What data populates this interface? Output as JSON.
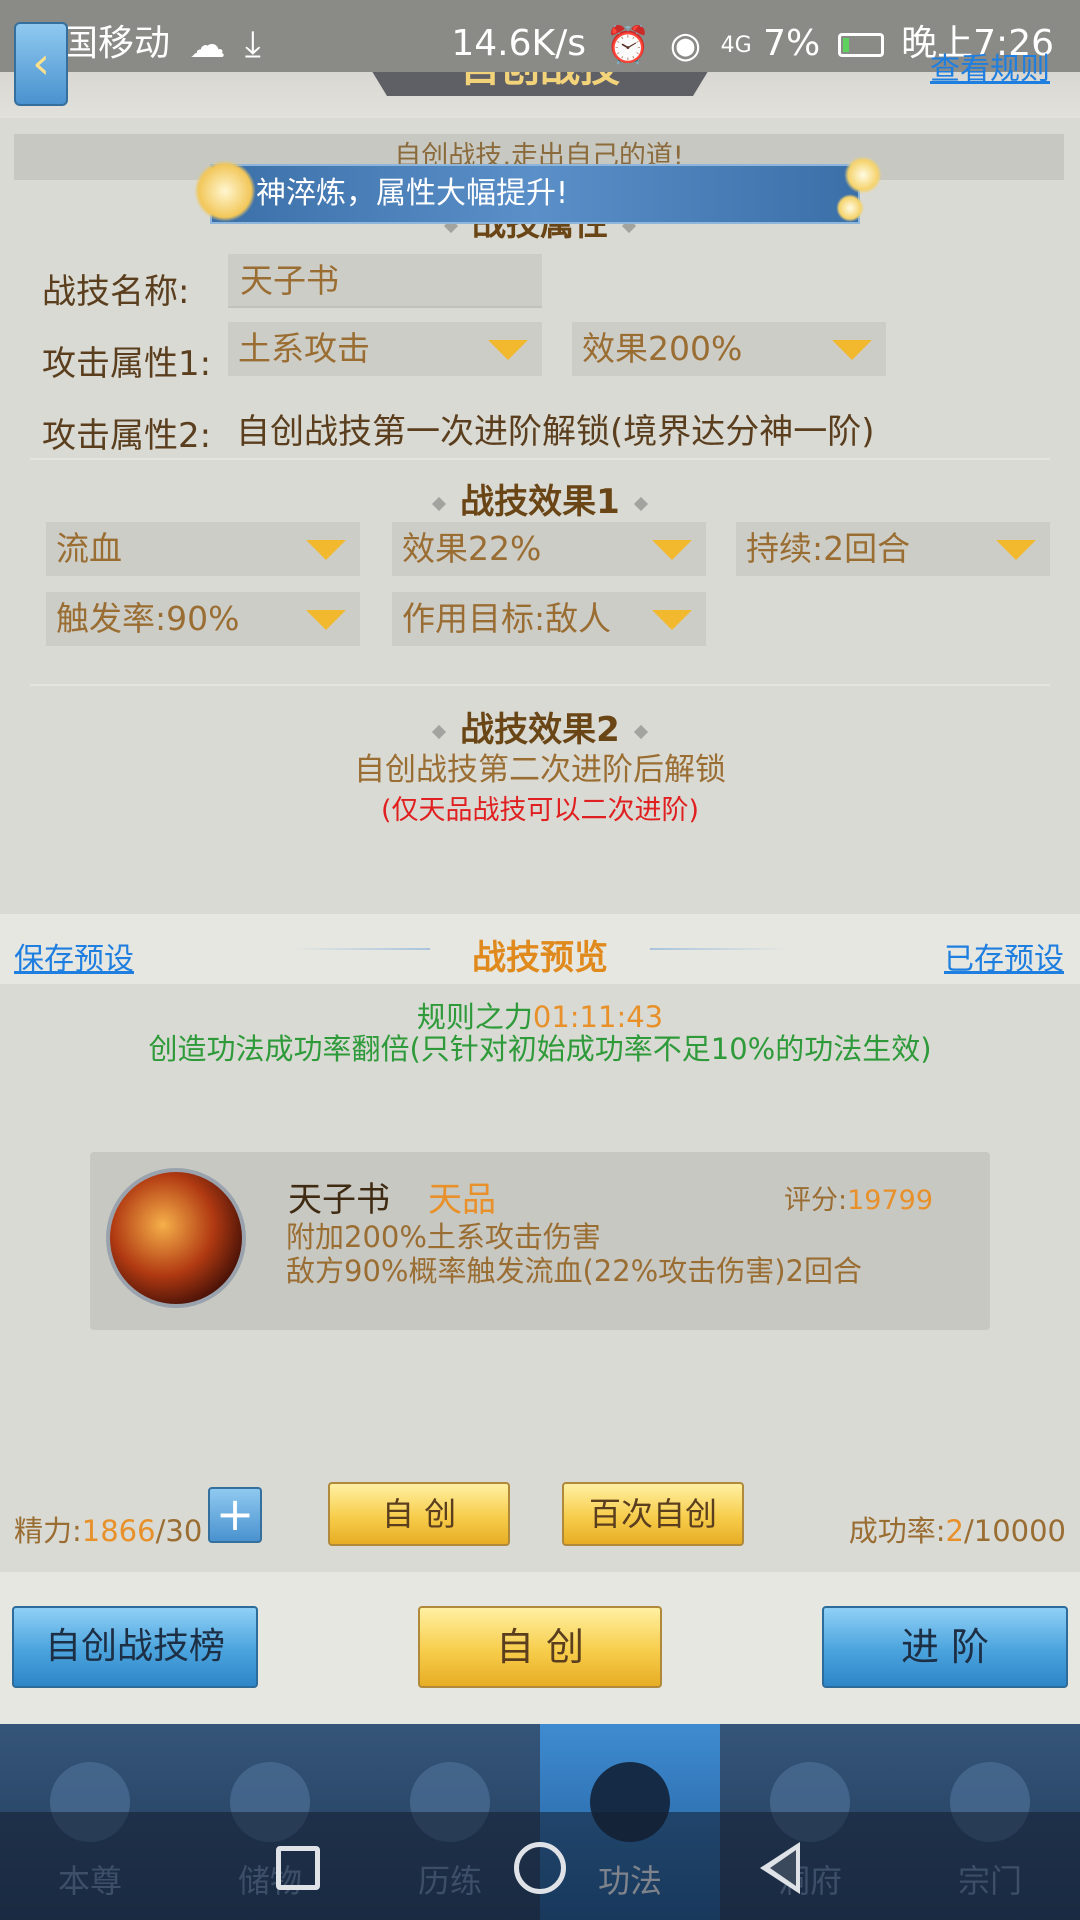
{
  "status_bar": {
    "carrier": "中国移动",
    "speed": "14.6K/s",
    "network": "4G",
    "battery": "7%",
    "time": "晚上7:26"
  },
  "header": {
    "title": "自创战技",
    "rules_link": "查看规则"
  },
  "slogan": "自创战技,走出自己的道!",
  "banner": "神淬炼，属性大幅提升!",
  "attributes": {
    "section_title": "战技属性",
    "name_label": "战技名称:",
    "name_value": "天子书",
    "attack1_label": "攻击属性1:",
    "attack1_value": "土系攻击",
    "attack1_effect": "效果200%",
    "attack2_label": "攻击属性2:",
    "attack2_value": "自创战技第一次进阶解锁(境界达分神一阶)"
  },
  "effect1": {
    "title": "战技效果1",
    "type": "流血",
    "effect": "效果22%",
    "duration": "持续:2回合",
    "trigger": "触发率:90%",
    "target": "作用目标:敌人"
  },
  "effect2": {
    "title": "战技效果2",
    "unlock": "自创战技第二次进阶后解锁",
    "note": "(仅天品战技可以二次进阶)"
  },
  "preview": {
    "save_preset": "保存预设",
    "title": "战技预览",
    "saved_presets": "已存预设"
  },
  "rule_power": {
    "label": "规则之力",
    "timer": "01:11:43",
    "desc": "创造功法成功率翻倍(只针对初始成功率不足10%的功法生效)"
  },
  "skill_card": {
    "name": "天子书",
    "grade": "天品",
    "score_label": "评分:",
    "score": "19799",
    "line1": "附加200%土系攻击伤害",
    "line2": "敌方90%概率触发流血(22%攻击伤害)2回合"
  },
  "stats": {
    "energy_label": "精力:",
    "energy_value": "1866",
    "energy_cost": "/30",
    "success_label": "成功率:",
    "success_value": "2",
    "success_total": "/10000"
  },
  "buttons": {
    "create": "自 创",
    "create100": "百次自创",
    "ranking": "自创战技榜",
    "create_main": "自 创",
    "advance": "进 阶"
  },
  "nav": {
    "tabs": [
      "本尊",
      "储物",
      "历练",
      "功法",
      "洞府",
      "宗门"
    ],
    "active_index": 3
  },
  "colors": {
    "accent_gold": "#f7cd4b",
    "accent_blue": "#4aa3dd",
    "link_blue": "#1f7fe0",
    "warning_red": "#e02020",
    "success_green": "#2e9a3a",
    "value_orange": "#e8902a"
  }
}
